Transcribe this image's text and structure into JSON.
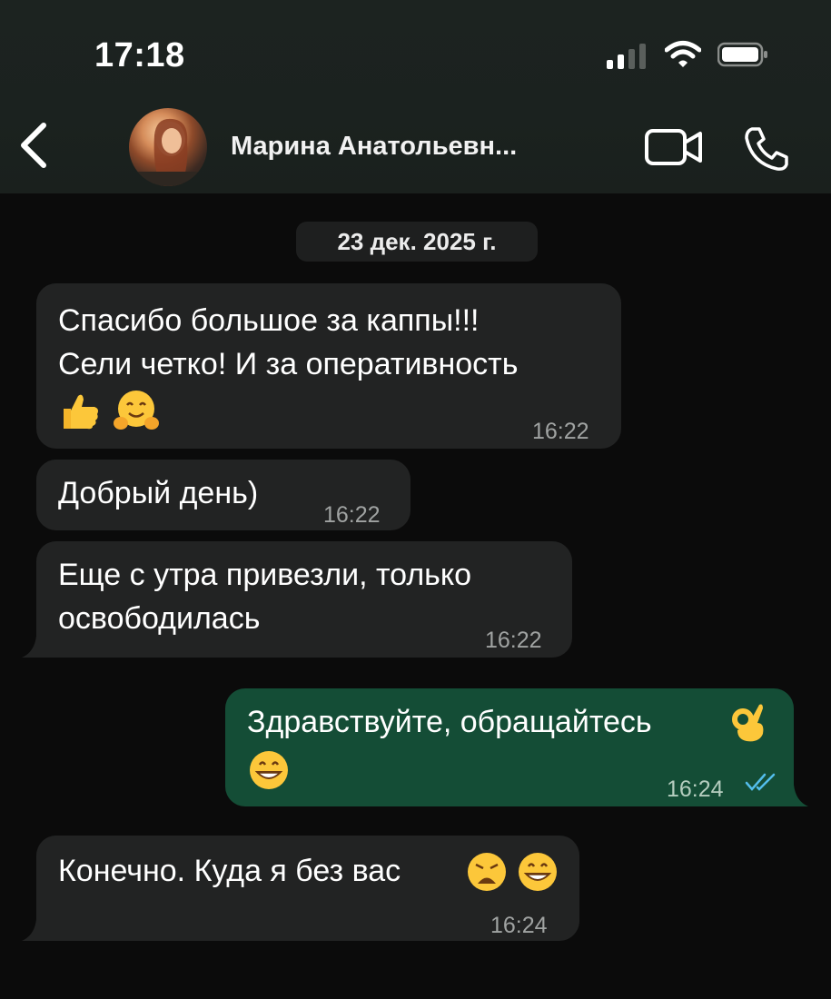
{
  "status_bar": {
    "time": "17:18"
  },
  "header": {
    "contact_name": "Марина Анатольевн...",
    "icons": [
      "back-chevron-icon",
      "avatar",
      "video-call-icon",
      "phone-icon"
    ]
  },
  "chat": {
    "date_separator": "23 дек. 2025 г.",
    "messages": [
      {
        "direction": "in",
        "lines": [
          "Спасибо большое за каппы!!!",
          "Сели четко! И за оперативность"
        ],
        "emojis": [
          "thumbs-up",
          "hugging-face"
        ],
        "time": "16:22"
      },
      {
        "direction": "in",
        "lines": [
          "Добрый день)"
        ],
        "time": "16:22"
      },
      {
        "direction": "in",
        "lines": [
          "Еще с утра привезли, только",
          "освободилась"
        ],
        "time": "16:22"
      },
      {
        "direction": "out",
        "lines": [
          "Здравствуйте, обращайтесь"
        ],
        "emojis": [
          "ok-hand",
          "grinning-face"
        ],
        "time": "16:24",
        "status": "read"
      },
      {
        "direction": "in",
        "lines": [
          "Конечно. Куда я без вас"
        ],
        "emojis": [
          "weary-face",
          "grinning-face"
        ],
        "time": "16:24"
      }
    ]
  },
  "colors": {
    "background": "#0b0b0b",
    "incoming_bubble": "#222323",
    "outgoing_bubble": "#144d36",
    "read_ticks": "#53bdeb"
  }
}
